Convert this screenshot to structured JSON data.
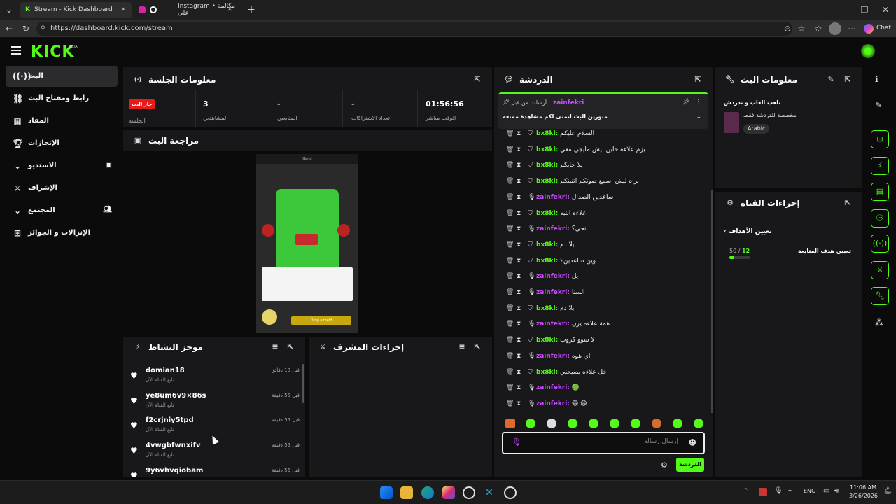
{
  "browser": {
    "tabs": [
      {
        "title": "Stream - Kick Dashboard",
        "active": true
      },
      {
        "title": "Instagram • مكالمة على",
        "active": false
      }
    ],
    "new_tab": "+",
    "url": "https://dashboard.kick.com/stream",
    "chat_label": "Chat"
  },
  "app": {
    "logo": "KICK",
    "beta": "BETA",
    "sidebar": [
      {
        "label": "البث",
        "icon": "broadcast-icon",
        "active": true
      },
      {
        "label": "رابط ومفتاح البث",
        "icon": "link-icon"
      },
      {
        "label": "المقاد",
        "icon": "chart-icon"
      },
      {
        "label": "الإنجازات",
        "icon": "trophy-icon"
      },
      {
        "label": "الاستديو",
        "icon": "chevron-icon"
      },
      {
        "label": "الإشراف",
        "icon": "sword-icon"
      },
      {
        "label": "المجتمع",
        "icon": "chevron-icon"
      },
      {
        "label": "الإنزالات و الجوائز",
        "icon": "gift-icon"
      }
    ]
  },
  "session": {
    "title": "معلومات الجلسة",
    "live_badge": "جار البث",
    "session_label": "الجلسة",
    "stats": [
      {
        "value": "3",
        "label": "المشاهدين"
      },
      {
        "value": "-",
        "label": "المتابعين"
      },
      {
        "value": "-",
        "label": "تعداد الاشتراكات"
      },
      {
        "value": "01:56:56",
        "label": "الوقت مباشر"
      }
    ]
  },
  "preview": {
    "title": "مراجعة البث",
    "game_button": "Drop a meld",
    "game_top": "Hand"
  },
  "activity": {
    "title": "موجز النشاط",
    "items": [
      {
        "name": "domian18",
        "sub": "تابع القناة الآن",
        "time": "قبل 10 دقائق"
      },
      {
        "name": "ye8um6v9×86s",
        "sub": "تابع القناة الآن",
        "time": "قبل 55 دقيقة"
      },
      {
        "name": "f2crjniy5tpd",
        "sub": "تابع القناة الآن",
        "time": "قبل 55 دقيقة"
      },
      {
        "name": "4vwgbfwnxifv",
        "sub": "تابع القناة الآن",
        "time": "قبل 55 دقيقة"
      },
      {
        "name": "9y6vhvqiobam",
        "sub": "",
        "time": "قبل 55 دقيقة"
      }
    ]
  },
  "mod_actions": {
    "title": "إجراءات المشرف"
  },
  "chat": {
    "title": "الدردشة",
    "pinned": {
      "by": "أرسلت من قبل",
      "user": "zainfekri",
      "text": "متورين البث اتمنى لكم مشاهدة ممتعة"
    },
    "messages": [
      {
        "user": "bx8kl",
        "text": "السلام عليكم",
        "color": "#53fc18"
      },
      {
        "user": "bx8kl",
        "text": "يزم علاءه خاين ليش مايجي معي",
        "color": "#53fc18"
      },
      {
        "user": "bx8kl",
        "text": "يلا جايكم",
        "color": "#53fc18"
      },
      {
        "user": "bx8kl",
        "text": "براه ليش اسمع صوتكم اثنينكم",
        "color": "#53fc18"
      },
      {
        "user": "zainfekri",
        "text": "ساعدين الصدال",
        "color": "#c84bff"
      },
      {
        "user": "bx8kl",
        "text": "علاءه انتبه",
        "color": "#53fc18"
      },
      {
        "user": "zainfekri",
        "text": "نجي؟",
        "color": "#c84bff"
      },
      {
        "user": "bx8kl",
        "text": "يلا دم",
        "color": "#53fc18"
      },
      {
        "user": "bx8kl",
        "text": "وين ساعدين؟",
        "color": "#53fc18"
      },
      {
        "user": "zainfekri",
        "text": "يل",
        "color": "#c84bff"
      },
      {
        "user": "zainfekri",
        "text": "السنا",
        "color": "#c84bff"
      },
      {
        "user": "bx8kl",
        "text": "يلا دم",
        "color": "#53fc18"
      },
      {
        "user": "zainfekri",
        "text": "همة علاءه يرن",
        "color": "#c84bff"
      },
      {
        "user": "bx8kl",
        "text": "لا سوو كروب",
        "color": "#53fc18"
      },
      {
        "user": "zainfekri",
        "text": "اي هوه",
        "color": "#c84bff"
      },
      {
        "user": "bx8kl",
        "text": "خل علاءه يصيحني",
        "color": "#53fc18"
      },
      {
        "user": "zainfekri",
        "text": "🟢",
        "color": "#c84bff"
      },
      {
        "user": "zainfekri",
        "text": "😄 😄",
        "color": "#c84bff"
      }
    ],
    "input_placeholder": "إرسال رسالة",
    "send_label": "الدردشة"
  },
  "stream_info": {
    "title": "معلومات البث",
    "category": "نلعب العاب و ندردش",
    "desc": "مخصصة للدردشة فقط",
    "language": "Arabic"
  },
  "channel_actions": {
    "title": "إجراءات القناة",
    "goal_header": "تعيين الأهداف",
    "goal_label": "تعيين هدف المتابعة",
    "goal_current": "12",
    "goal_total": "50",
    "goal_progress": 0.24
  },
  "taskbar": {
    "lang": "ENG",
    "time": "11:06 AM",
    "date": "3/26/2026"
  }
}
